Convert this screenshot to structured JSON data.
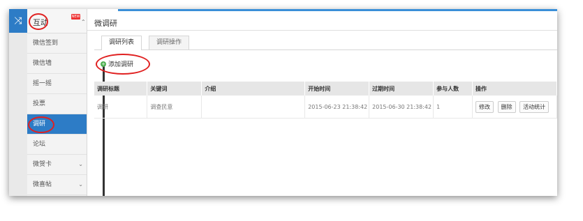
{
  "rail": {
    "icon": "shuffle-icon",
    "glyph": "⤨"
  },
  "sidebar": {
    "header": {
      "label": "互动",
      "badge": "NEW",
      "caret": "⌃"
    },
    "items": [
      {
        "label": "微信签到",
        "chev": ""
      },
      {
        "label": "微信墙",
        "chev": ""
      },
      {
        "label": "摇一摇",
        "chev": ""
      },
      {
        "label": "投票",
        "chev": ""
      },
      {
        "label": "调研",
        "chev": ""
      },
      {
        "label": "论坛",
        "chev": ""
      },
      {
        "label": "微贺卡",
        "chev": "⌄"
      },
      {
        "label": "微喜帖",
        "chev": "⌄"
      }
    ]
  },
  "main": {
    "title": "微调研",
    "tabs": [
      {
        "label": "调研列表"
      },
      {
        "label": "调研操作"
      }
    ],
    "add_button": "添加调研",
    "table": {
      "headers": [
        "调研标题",
        "关键词",
        "介绍",
        "开始时间",
        "过期时间",
        "参与人数",
        "操作"
      ],
      "rows": [
        {
          "title": "调研",
          "keyword": "调查民意",
          "intro": "",
          "start": "2015-06-23 21:38:42",
          "end": "2015-06-30 21:38:42",
          "count": "1",
          "actions": [
            "修改",
            "删除",
            "活动统计"
          ]
        }
      ]
    }
  },
  "colors": {
    "accent": "#2d7cc6",
    "annotation": "#e02020"
  }
}
